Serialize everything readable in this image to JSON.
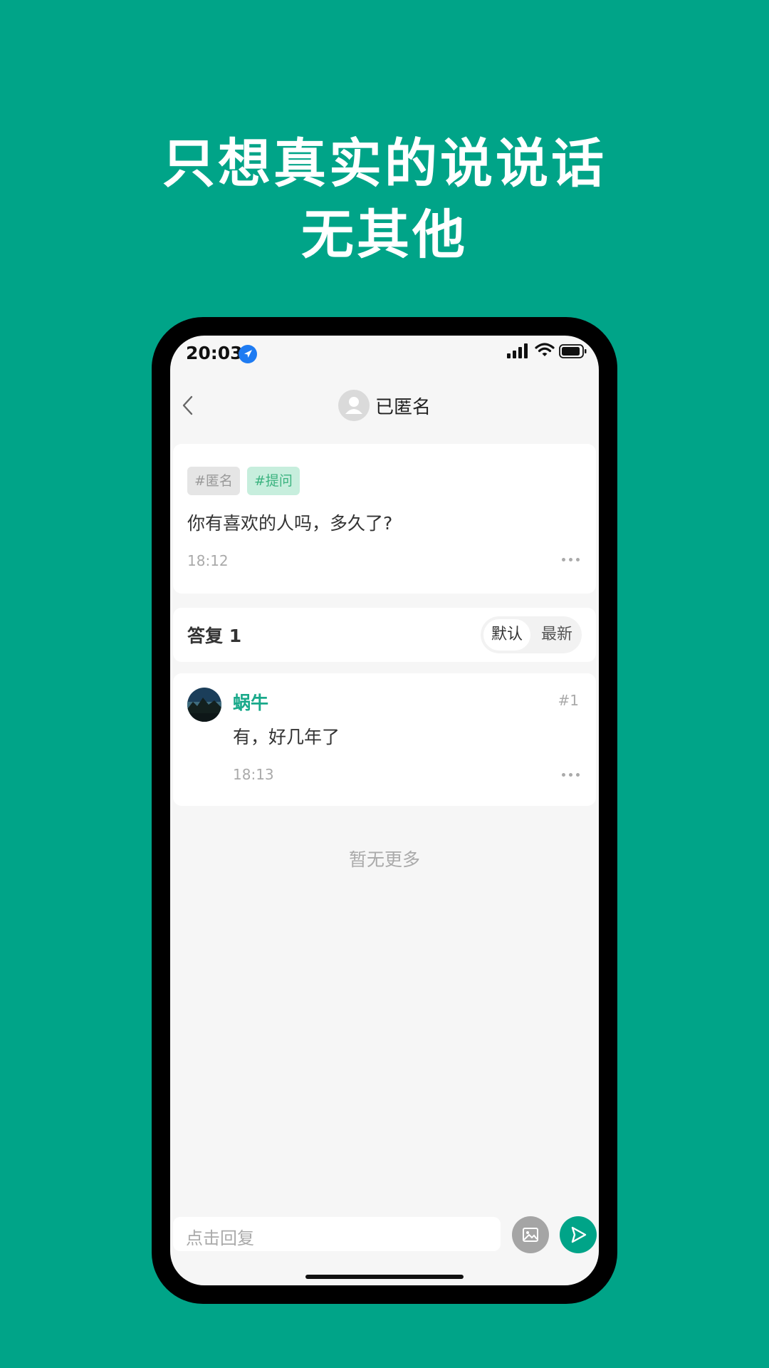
{
  "promo": {
    "headline_line1": "只想真实的说说话",
    "headline_line2": "无其他",
    "background_color": "#00A488"
  },
  "status_bar": {
    "time": "20:03",
    "icons": [
      "location-arrow-icon",
      "cellular-signal-icon",
      "wifi-icon",
      "battery-icon"
    ]
  },
  "nav": {
    "back_icon": "chevron-left-icon",
    "avatar_icon": "user-avatar-icon",
    "title": "已匿名"
  },
  "post": {
    "tags": [
      "#匿名",
      "#提问"
    ],
    "text": "你有喜欢的人吗，多久了?",
    "time": "18:12",
    "more_icon": "more-dots-icon"
  },
  "replies_header": {
    "label": "答复 1",
    "sort_options": [
      "默认",
      "最新"
    ],
    "selected_sort": "默认"
  },
  "replies": [
    {
      "name": "蜗牛",
      "floor": "#1",
      "text": "有，好几年了",
      "time": "18:13",
      "name_color": "#19A98A"
    }
  ],
  "empty_hint": "暂无更多",
  "composer": {
    "placeholder": "点击回复",
    "image_icon": "image-icon",
    "send_icon": "send-icon"
  }
}
